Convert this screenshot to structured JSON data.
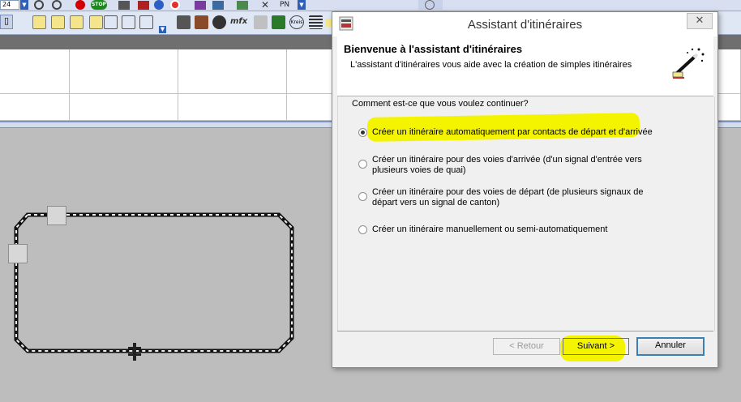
{
  "toolbar_top": {
    "zoom_value": "24",
    "stop_label": "STOP",
    "pn_label": "PN"
  },
  "toolbar": {
    "mfx_label": "mfx",
    "kreis_label": "Kreis",
    "icons": [
      "grid-icon",
      "track-edit-icon",
      "track-curve-icon",
      "track-switch-icon",
      "block-icon",
      "turntable-icon",
      "crossing-icon",
      "print-icon",
      "panel-icon",
      "loco-icon",
      "mfx-icon",
      "paint-icon",
      "signal-icon",
      "kreis-icon",
      "list-icon"
    ]
  },
  "dialog": {
    "title": "Assistant d'itinéraires",
    "close_symbol": "✕",
    "header_title": "Bienvenue à l'assistant d'itinéraires",
    "header_subtitle": "L'assistant d'itinéraires vous aide avec la création de simples itinéraires",
    "question": "Comment est-ce que vous voulez continuer?",
    "options": [
      {
        "line1": "Créer un itinéraire automatiquement par contacts de départ et d'arrivée",
        "line2": "",
        "selected": true
      },
      {
        "line1": "Créer un itinéraire pour des voies d'arrivée (d'un signal d'entrée vers",
        "line2": "plusieurs voies de quai)",
        "selected": false
      },
      {
        "line1": "Créer un itinéraire pour des voies de départ (de plusieurs signaux de",
        "line2": "départ vers un signal de canton)",
        "selected": false
      },
      {
        "line1": "Créer un itinéraire manuellement ou semi-automatiquement",
        "line2": "",
        "selected": false
      }
    ],
    "buttons": {
      "back": "< Retour",
      "next": "Suivant >",
      "cancel": "Annuler"
    },
    "highlight_color": "#f4f400"
  }
}
